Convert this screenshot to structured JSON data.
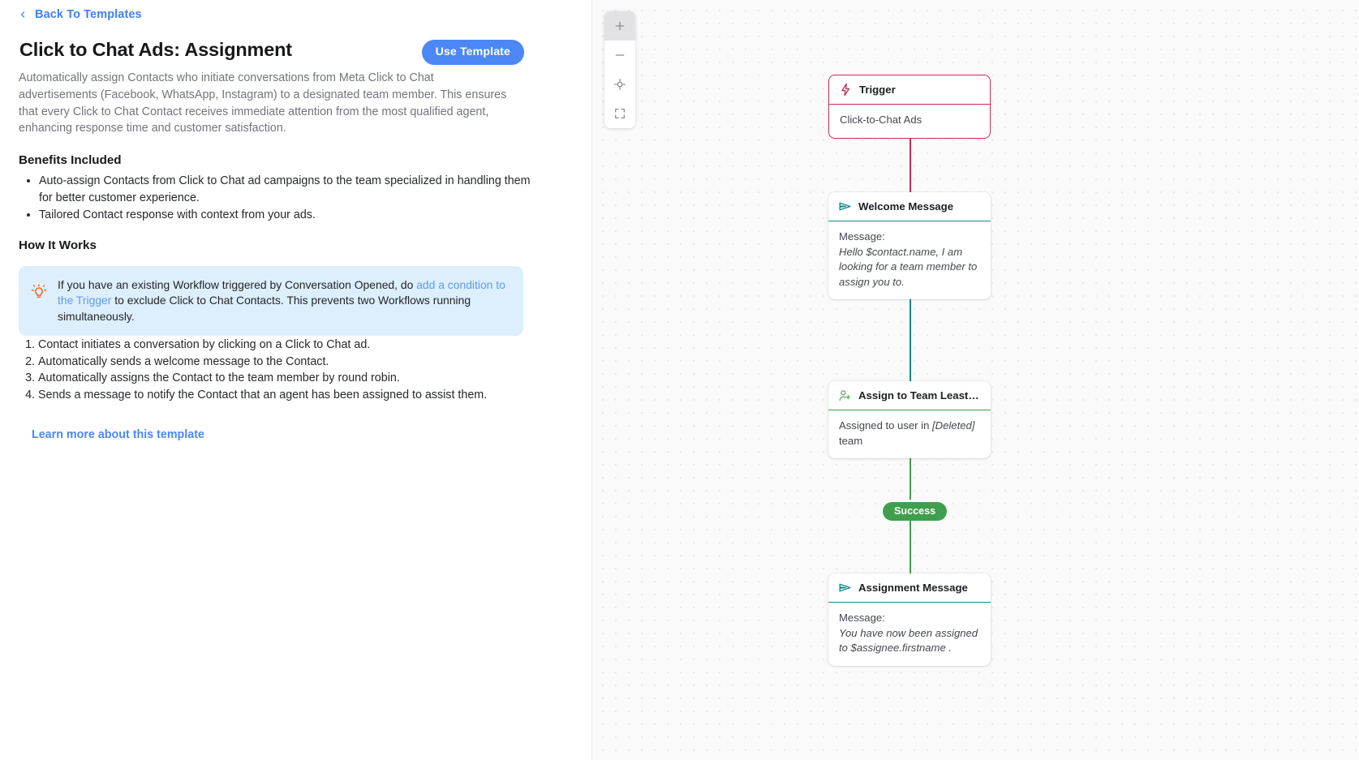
{
  "left": {
    "back_link": "Back To Templates",
    "title": "Click to Chat Ads: Assignment",
    "use_template_label": "Use Template",
    "intro": "Automatically assign Contacts who initiate conversations from Meta Click to Chat advertisements (Facebook, WhatsApp, Instagram) to a designated team member. This ensures that every Click to Chat Contact receives immediate attention from the most qualified agent, enhancing response time and customer satisfaction.",
    "benefits_heading": "Benefits Included",
    "benefits": [
      "Auto-assign Contacts from Click to Chat ad campaigns to the team specialized in handling them for better customer experience.",
      "Tailored Contact response with context from your ads."
    ],
    "how_heading": "How It Works",
    "callout": {
      "text_before": "If you have an existing Workflow triggered by Conversation Opened, do ",
      "link": "add a condition to the Trigger",
      "text_after": " to exclude Click to Chat Contacts. This prevents two Workflows running simultaneously."
    },
    "steps": [
      "Contact initiates a conversation by clicking on a Click to Chat ad.",
      "Automatically sends a welcome message to the Contact.",
      "Automatically assigns the Contact to the team member by round robin.",
      "Sends a message to notify the Contact that an agent has been assigned to assist them."
    ],
    "learn_more": "Learn more about this template"
  },
  "canvas": {
    "zoom_controls": [
      {
        "name": "zoom-in",
        "glyph": "+"
      },
      {
        "name": "zoom-out",
        "glyph": "-"
      },
      {
        "name": "recenter",
        "glyph": "target"
      },
      {
        "name": "fit-to-screen",
        "glyph": "expand"
      }
    ],
    "success_badge": "Success",
    "nodes": [
      {
        "name": "trigger",
        "title": "Trigger",
        "icon": "lightning-icon",
        "body": "Click-to-Chat Ads",
        "accent": "#c62a57"
      },
      {
        "name": "welcome-message",
        "title": "Welcome Message",
        "icon": "send-icon",
        "body_label": "Message:",
        "body_italic": "Hello $contact.name, I am looking for a team member to assign you to.",
        "accent": "#0f8c83"
      },
      {
        "name": "assign-to-team",
        "title": "Assign to Team Least C…",
        "icon": "person-add-icon",
        "body_before": "Assigned to user in ",
        "body_italic": "[Deleted]",
        "body_after": " team",
        "accent": "#3c9d4e"
      },
      {
        "name": "assignment-message",
        "title": "Assignment Message",
        "icon": "send-icon",
        "body_label": "Message:",
        "body_italic": "You have now been assigned to $assignee.firstname .",
        "accent": "#0f8c83"
      }
    ]
  }
}
